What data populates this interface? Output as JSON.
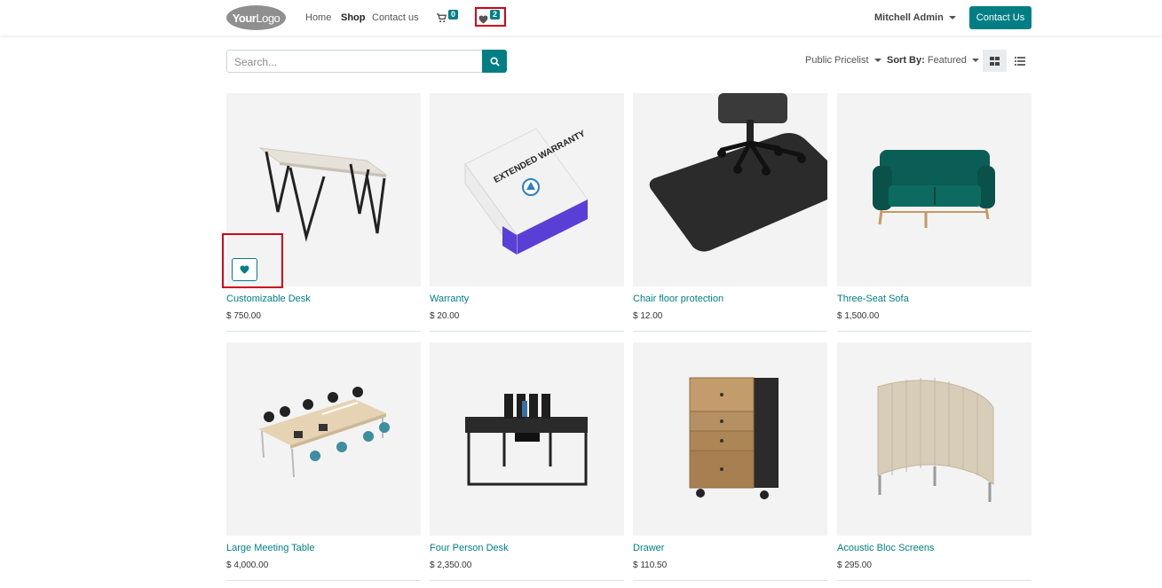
{
  "header": {
    "logo": {
      "bold": "Your",
      "rest": "Logo"
    },
    "nav": [
      {
        "label": "Home"
      },
      {
        "label": "Shop"
      },
      {
        "label": "Contact us"
      }
    ],
    "cart_count": "0",
    "wishlist_count": "2",
    "user": "Mitchell Admin",
    "contact_button": "Contact Us"
  },
  "toolbar": {
    "search_placeholder": "Search...",
    "pricelist": "Public Pricelist",
    "sort_label": "Sort By:",
    "sort_value": "Featured"
  },
  "products": [
    {
      "name": "Customizable Desk",
      "price": "$ 750.00"
    },
    {
      "name": "Warranty",
      "price": "$ 20.00"
    },
    {
      "name": "Chair floor protection",
      "price": "$ 12.00"
    },
    {
      "name": "Three-Seat Sofa",
      "price": "$ 1,500.00"
    },
    {
      "name": "Large Meeting Table",
      "price": "$ 4,000.00"
    },
    {
      "name": "Four Person Desk",
      "price": "$ 2,350.00"
    },
    {
      "name": "Drawer",
      "price": "$ 110.50"
    },
    {
      "name": "Acoustic Bloc Screens",
      "price": "$ 295.00"
    }
  ],
  "warranty_box_text": "EXTENDED WARRANTY",
  "colors": {
    "accent": "#017e84",
    "highlight": "#d0021b"
  }
}
